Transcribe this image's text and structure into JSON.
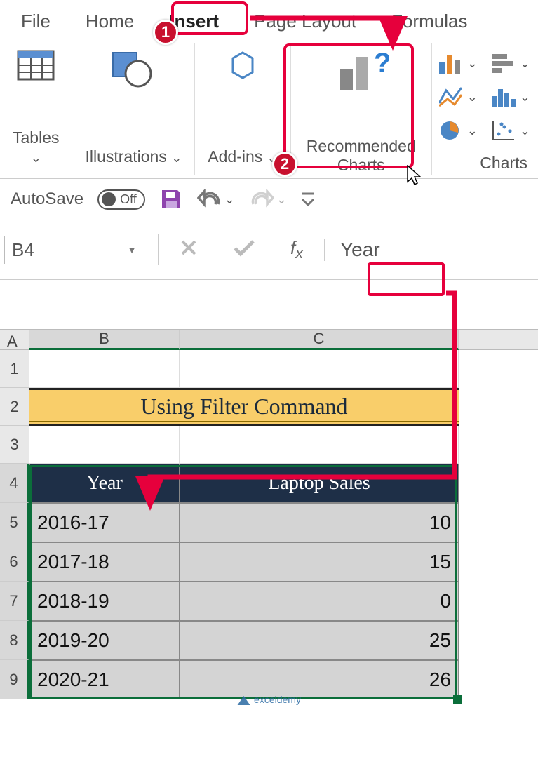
{
  "ribbon": {
    "tabs": {
      "file": "File",
      "home": "Home",
      "insert": "Insert",
      "page_layout": "Page Layout",
      "formulas": "Formulas"
    },
    "groups": {
      "tables_label": "Tables",
      "illustrations_label": "Illustrations",
      "addins_label": "Add-ins",
      "recommended_charts_label_line1": "Recommended",
      "recommended_charts_label_line2": "Charts",
      "charts_label": "Charts"
    }
  },
  "qat": {
    "autosave_label": "AutoSave",
    "autosave_state": "Off"
  },
  "formula_bar": {
    "name_box": "B4",
    "fx_value": "Year"
  },
  "sheet": {
    "columns": {
      "a": "A",
      "b": "B",
      "c": "C"
    },
    "rows": [
      "1",
      "2",
      "3",
      "4",
      "5",
      "6",
      "7",
      "8",
      "9"
    ],
    "title": "Using Filter Command",
    "table": {
      "header": {
        "year": "Year",
        "sales": "Laptop Sales"
      },
      "rows": [
        {
          "year": "2016-17",
          "sales": "10"
        },
        {
          "year": "2017-18",
          "sales": "15"
        },
        {
          "year": "2018-19",
          "sales": "0"
        },
        {
          "year": "2019-20",
          "sales": "25"
        },
        {
          "year": "2020-21",
          "sales": "26"
        }
      ]
    }
  },
  "annotations": {
    "badge1": "1",
    "badge2": "2"
  },
  "watermark": "exceldemy",
  "chart_data": {
    "type": "table",
    "title": "Using Filter Command",
    "categories": [
      "2016-17",
      "2017-18",
      "2018-19",
      "2019-20",
      "2020-21"
    ],
    "values": [
      10,
      15,
      0,
      25,
      26
    ],
    "xlabel": "Year",
    "ylabel": "Laptop Sales"
  }
}
